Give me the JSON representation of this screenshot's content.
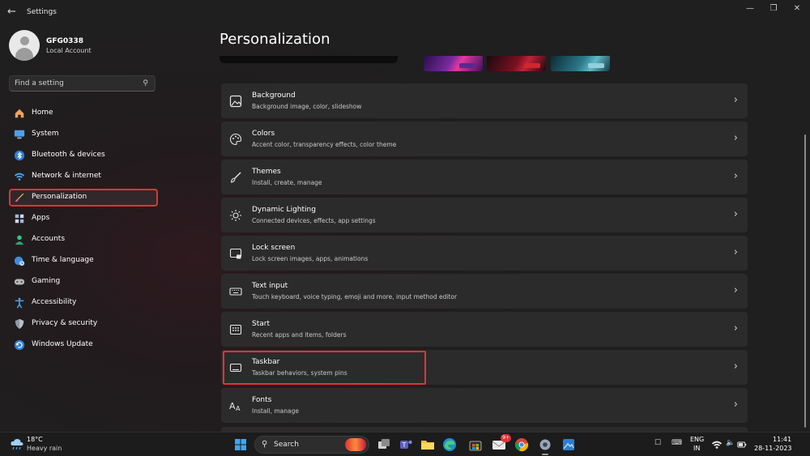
{
  "window": {
    "title": "Settings",
    "controls": {
      "minimize": "—",
      "maximize": "❐",
      "close": "✕"
    }
  },
  "profile": {
    "name": "GFG0338",
    "account_type": "Local Account"
  },
  "search": {
    "placeholder": "Find a setting"
  },
  "sidebar": {
    "items": [
      {
        "label": "Home",
        "icon": "home-icon"
      },
      {
        "label": "System",
        "icon": "monitor-icon"
      },
      {
        "label": "Bluetooth & devices",
        "icon": "bluetooth-icon"
      },
      {
        "label": "Network & internet",
        "icon": "wifi-icon"
      },
      {
        "label": "Personalization",
        "icon": "paintbrush-icon",
        "selected": true
      },
      {
        "label": "Apps",
        "icon": "apps-grid-icon"
      },
      {
        "label": "Accounts",
        "icon": "person-icon"
      },
      {
        "label": "Time & language",
        "icon": "globe-clock-icon"
      },
      {
        "label": "Gaming",
        "icon": "gamepad-icon"
      },
      {
        "label": "Accessibility",
        "icon": "accessibility-icon"
      },
      {
        "label": "Privacy & security",
        "icon": "shield-icon"
      },
      {
        "label": "Windows Update",
        "icon": "update-icon"
      }
    ]
  },
  "main": {
    "title": "Personalization",
    "rows": [
      {
        "title": "Background",
        "subtitle": "Background image, color, slideshow",
        "icon": "image-icon"
      },
      {
        "title": "Colors",
        "subtitle": "Accent color, transparency effects, color theme",
        "icon": "palette-icon"
      },
      {
        "title": "Themes",
        "subtitle": "Install, create, manage",
        "icon": "brush-icon"
      },
      {
        "title": "Dynamic Lighting",
        "subtitle": "Connected devices, effects, app settings",
        "icon": "sun-icon"
      },
      {
        "title": "Lock screen",
        "subtitle": "Lock screen images, apps, animations",
        "icon": "lock-screen-icon"
      },
      {
        "title": "Text input",
        "subtitle": "Touch keyboard, voice typing, emoji and more, input method editor",
        "icon": "keyboard-icon"
      },
      {
        "title": "Start",
        "subtitle": "Recent apps and items, folders",
        "icon": "start-icon"
      },
      {
        "title": "Taskbar",
        "subtitle": "Taskbar behaviors, system pins",
        "icon": "taskbar-icon",
        "highlighted": true
      },
      {
        "title": "Fonts",
        "subtitle": "Install, manage",
        "icon": "fonts-icon"
      }
    ]
  },
  "taskbar": {
    "weather": {
      "temp": "18°C",
      "desc": "Heavy rain"
    },
    "search_label": "Search",
    "notification_count": "9+",
    "language": {
      "line1": "ENG",
      "line2": "IN"
    },
    "clock": {
      "time": "11:41",
      "date": "28-11-2023"
    }
  },
  "colors": {
    "accent_highlight": "#e0333a",
    "background": "#1f1f1f",
    "card": "#2b2b2b"
  }
}
